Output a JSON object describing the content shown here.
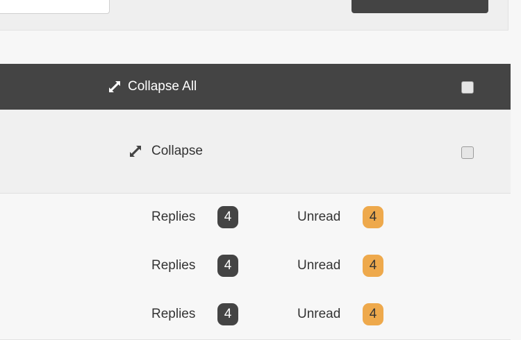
{
  "header": {
    "collapse_all_label": "Collapse All"
  },
  "group": {
    "collapse_label": "Collapse"
  },
  "threads": [
    {
      "replies_label": "Replies",
      "replies_count": "4",
      "unread_label": "Unread",
      "unread_count": "4"
    },
    {
      "replies_label": "Replies",
      "replies_count": "4",
      "unread_label": "Unread",
      "unread_count": "4"
    },
    {
      "replies_label": "Replies",
      "replies_count": "4",
      "unread_label": "Unread",
      "unread_count": "4"
    }
  ],
  "colors": {
    "header_bg": "#444444",
    "unread_badge": "#eea94c",
    "replies_badge": "#444444"
  },
  "icons": {
    "collapse": "collapse-arrows-icon"
  }
}
